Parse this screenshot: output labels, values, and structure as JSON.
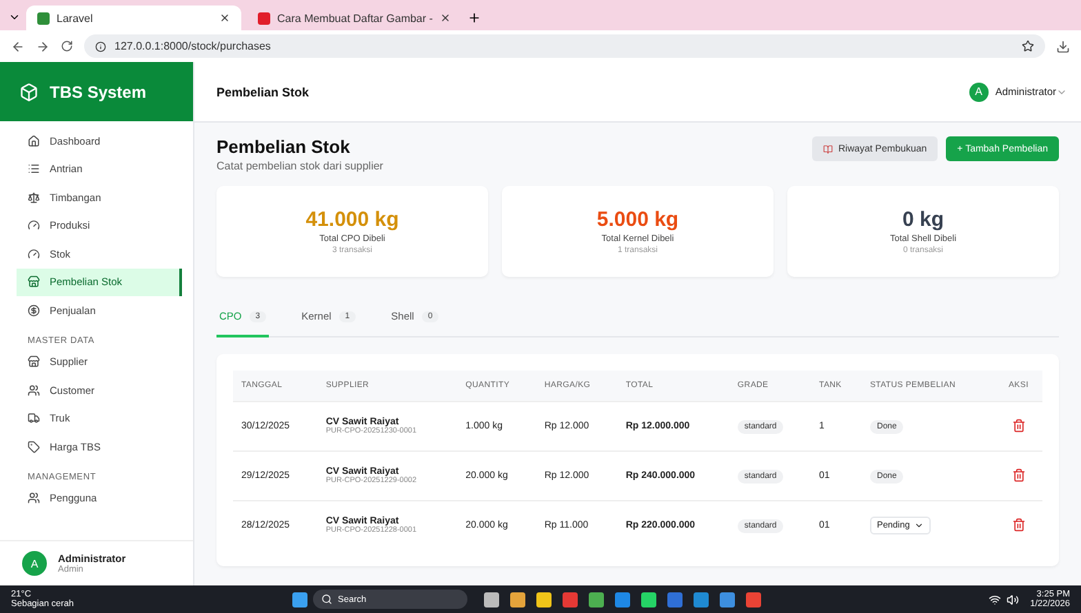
{
  "browser": {
    "tabs": [
      {
        "title": "Laravel",
        "selected": true
      },
      {
        "title": "Cara Membuat Daftar Gambar -",
        "selected": false
      }
    ],
    "url": "127.0.0.1:8000/stock/purchases"
  },
  "app": {
    "brand": "TBS System",
    "header_title": "Pembelian Stok",
    "user": {
      "initial": "A",
      "name": "Administrator"
    }
  },
  "sidebar": {
    "sections": [
      {
        "items": [
          {
            "label": "Dashboard",
            "kind": "home",
            "selected": false
          },
          {
            "label": "Antrian",
            "kind": "list",
            "selected": false
          },
          {
            "label": "Timbangan",
            "kind": "scale",
            "selected": false
          },
          {
            "label": "Produksi",
            "kind": "gauge",
            "selected": false
          },
          {
            "label": "Stok",
            "kind": "gauge",
            "selected": false
          },
          {
            "label": "Pembelian Stok",
            "kind": "store",
            "selected": true
          },
          {
            "label": "Penjualan",
            "kind": "coin",
            "selected": false
          }
        ]
      },
      {
        "heading": "MASTER DATA",
        "items": [
          {
            "label": "Supplier",
            "kind": "store",
            "selected": false
          },
          {
            "label": "Customer",
            "kind": "users",
            "selected": false
          },
          {
            "label": "Truk",
            "kind": "truck",
            "selected": false
          },
          {
            "label": "Harga TBS",
            "kind": "tag",
            "selected": false
          }
        ]
      },
      {
        "heading": "MANAGEMENT",
        "items": [
          {
            "label": "Pengguna",
            "kind": "users",
            "selected": false
          }
        ]
      }
    ],
    "footer": {
      "initial": "A",
      "name": "Administrator",
      "role": "Admin"
    }
  },
  "page": {
    "title": "Pembelian Stok",
    "subtitle": "Catat pembelian stok dari supplier",
    "buttons": [
      {
        "label": "Riwayat Pembukuan",
        "kind": "secondary"
      },
      {
        "label": "+ Tambah Pembelian",
        "kind": "primary"
      }
    ]
  },
  "cards": [
    {
      "value": "41.000 kg",
      "label": "Total CPO Dibeli",
      "note": "3 transaksi",
      "color": "#d4900a"
    },
    {
      "value": "5.000 kg",
      "label": "Total Kernel Dibeli",
      "note": "1 transaksi",
      "color": "#ea4c12"
    },
    {
      "value": "0 kg",
      "label": "Total Shell Dibeli",
      "note": "0 transaksi",
      "color": "#374151"
    }
  ],
  "tabs": [
    {
      "label": "CPO",
      "count": "3",
      "selected": true
    },
    {
      "label": "Kernel",
      "count": "1",
      "selected": false
    },
    {
      "label": "Shell",
      "count": "0",
      "selected": false
    }
  ],
  "table": {
    "columns": [
      "TANGGAL",
      "SUPPLIER",
      "QUANTITY",
      "HARGA/KG",
      "TOTAL",
      "GRADE",
      "TANK",
      "STATUS PEMBELIAN",
      "AKSI"
    ],
    "rows": [
      {
        "date": "30/12/2025",
        "supplier": "CV Sawit Raiyat",
        "code": "PUR-CPO-20251230-0001",
        "quantity": "1.000 kg",
        "price": "Rp 12.000",
        "total": "Rp 12.000.000",
        "grade": "standard",
        "tank": "1",
        "status": {
          "kind": "badge",
          "text": "Done"
        }
      },
      {
        "date": "29/12/2025",
        "supplier": "CV Sawit Raiyat",
        "code": "PUR-CPO-20251229-0002",
        "quantity": "20.000 kg",
        "price": "Rp 12.000",
        "total": "Rp 240.000.000",
        "grade": "standard",
        "tank": "01",
        "status": {
          "kind": "badge",
          "text": "Done"
        }
      },
      {
        "date": "28/12/2025",
        "supplier": "CV Sawit Raiyat",
        "code": "PUR-CPO-20251228-0001",
        "quantity": "20.000 kg",
        "price": "Rp 11.000",
        "total": "Rp 220.000.000",
        "grade": "standard",
        "tank": "01",
        "status": {
          "kind": "select",
          "text": "Pending"
        }
      }
    ]
  },
  "taskbar": {
    "weather_temp": "21°C",
    "weather_text": "Sebagian cerah",
    "search": "Search",
    "time": "3:25 PM",
    "date": "1/22/2026"
  }
}
